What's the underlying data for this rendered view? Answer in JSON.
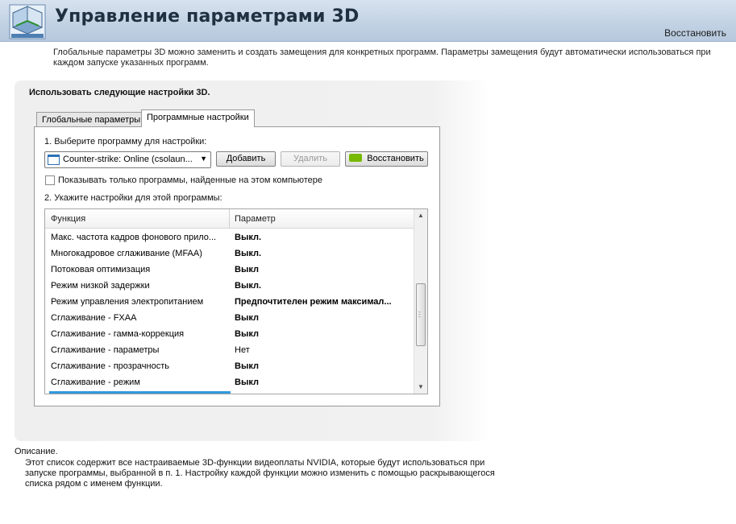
{
  "header": {
    "title": "Управление параметрами 3D",
    "restore_link": "Восстановить",
    "logo_icon": "nvidia-3d-cube-icon"
  },
  "intro_text": "Глобальные параметры 3D можно заменить и создать замещения для конкретных программ. Параметры замещения будут автоматически использоваться при каждом запуске указанных программ.",
  "panel": {
    "title": "Использовать следующие настройки 3D.",
    "tabs": [
      {
        "label": "Глобальные параметры",
        "active": false
      },
      {
        "label": "Программные настройки",
        "active": true
      }
    ],
    "step1_label": "1. Выберите программу для настройки:",
    "program_select": {
      "value": "Counter-strike: Online (csolaun...",
      "icon": "application-window-icon"
    },
    "buttons": {
      "add": "Добавить",
      "remove": "Удалить",
      "restore": "Восстановить"
    },
    "checkbox_label": "Показывать только программы, найденные на этом компьютере",
    "checkbox_checked": false,
    "step2_label": "2. Укажите настройки для этой программы:",
    "grid": {
      "columns": [
        "Функция",
        "Параметр"
      ],
      "rows": [
        {
          "function": "Макс. частота кадров фонового прило...",
          "value": "Выкл.",
          "bold": true
        },
        {
          "function": "Многокадровое сглаживание (MFAA)",
          "value": "Выкл.",
          "bold": true
        },
        {
          "function": "Потоковая оптимизация",
          "value": "Выкл",
          "bold": true
        },
        {
          "function": "Режим низкой задержки",
          "value": "Выкл.",
          "bold": true
        },
        {
          "function": "Режим управления электропитанием",
          "value": "Предпочтителен режим максимал...",
          "bold": true
        },
        {
          "function": "Сглаживание - FXAA",
          "value": "Выкл",
          "bold": true
        },
        {
          "function": "Сглаживание - гамма-коррекция",
          "value": "Выкл",
          "bold": true
        },
        {
          "function": "Сглаживание - параметры",
          "value": "Нет",
          "bold": false
        },
        {
          "function": "Сглаживание - прозрачность",
          "value": "Выкл",
          "bold": true
        },
        {
          "function": "Сглаживание - режим",
          "value": "Выкл",
          "bold": true
        }
      ]
    }
  },
  "description": {
    "title": "Описание.",
    "text": "Этот список содержит все настраиваемые 3D-функции видеоплаты NVIDIA, которые будут использоваться при запуске программы, выбранной в п. 1. Настройку каждой функции можно изменить с помощью раскрывающегося списка рядом с именем функции."
  },
  "colors": {
    "header_bg": "#c3d3e5",
    "nvidia_green": "#76b900",
    "selection_blue": "#3399dd"
  }
}
